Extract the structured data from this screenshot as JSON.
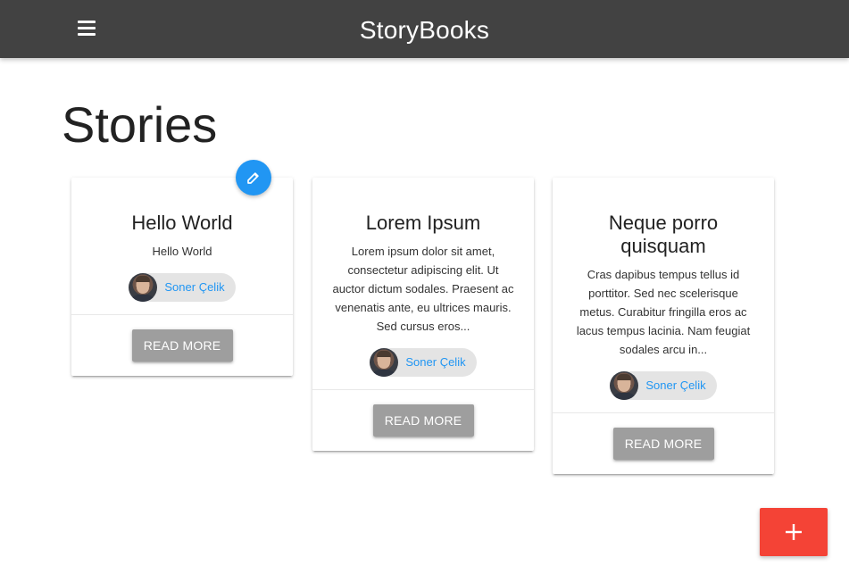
{
  "navbar": {
    "brand": "StoryBooks",
    "menu_icon": "hamburger-menu-icon"
  },
  "page": {
    "title": "Stories"
  },
  "cards": [
    {
      "title": "Hello World",
      "body": "Hello World",
      "author": "Soner Çelik",
      "button": "Read More"
    },
    {
      "title": "Lorem Ipsum",
      "body": "Lorem ipsum dolor sit amet, consectetur adipiscing elit. Ut auctor dictum sodales. Praesent ac venenatis ante, eu ultrices mauris. Sed cursus eros...",
      "author": "Soner Çelik",
      "button": "Read More"
    },
    {
      "title": "Neque porro quisquam",
      "body": "Cras dapibus tempus tellus id porttitor. Sed nec scelerisque metus. Curabitur fringilla eros ac lacus tempus lacinia. Nam feugiat sodales arcu in...",
      "author": "Soner Çelik",
      "button": "Read More"
    }
  ],
  "edit_button": {
    "icon": "edit-icon"
  },
  "add_button": {
    "label": "+",
    "icon": "add-icon"
  },
  "colors": {
    "navbar": "#424242",
    "accent_blue": "#2196f3",
    "accent_red": "#f44336",
    "button_grey": "#9e9e9e",
    "chip_bg": "#e4e4e4"
  }
}
